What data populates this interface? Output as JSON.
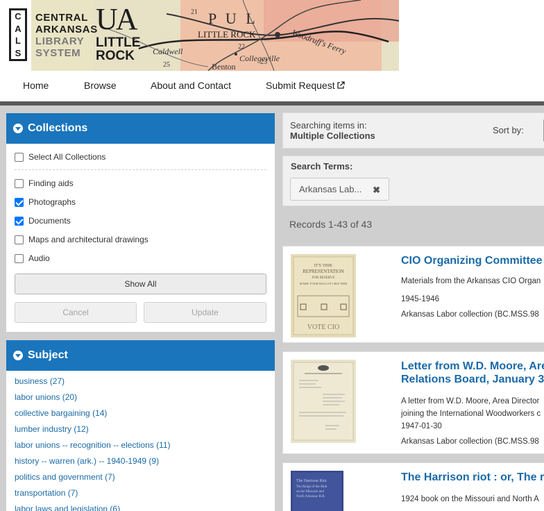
{
  "header": {
    "logo_letters": [
      "C",
      "A",
      "L",
      "S"
    ],
    "logo_lines": [
      "CENTRAL",
      "ARKANSAS",
      "LIBRARY",
      "SYSTEM"
    ],
    "ualr_mark": "UA",
    "ualr_lines": [
      "LITTLE",
      "ROCK"
    ],
    "map_labels": [
      "P  U  L",
      "LITTLE ROCK",
      "Woodruff's Ferry",
      "Caldwell",
      "Collegeville",
      "Benton",
      "22",
      "25",
      "23",
      "21"
    ]
  },
  "nav": {
    "items": [
      {
        "label": "Home"
      },
      {
        "label": "Browse"
      },
      {
        "label": "About and Contact"
      },
      {
        "label": "Submit Request",
        "icon": "external-link-icon"
      }
    ]
  },
  "collections": {
    "title": "Collections",
    "select_all": {
      "label": "Select All Collections",
      "checked": false
    },
    "options": [
      {
        "label": "Finding aids",
        "checked": false
      },
      {
        "label": "Photographs",
        "checked": true
      },
      {
        "label": "Documents",
        "checked": true
      },
      {
        "label": "Maps and architectural drawings",
        "checked": false
      },
      {
        "label": "Audio",
        "checked": false
      }
    ],
    "show_all": "Show All",
    "cancel": "Cancel",
    "update": "Update"
  },
  "subject": {
    "title": "Subject",
    "items": [
      "business (27)",
      "labor unions (20)",
      "collective bargaining (14)",
      "lumber industry (12)",
      "labor unions -- recognition -- elections (11)",
      "history -- warren (ark.) -- 1940-1949 (9)",
      "politics and government (7)",
      "transportation (7)",
      "labor laws and legislation (6)"
    ]
  },
  "search": {
    "searching_in_label": "Searching items in:",
    "searching_in_value": "Multiple Collections",
    "sort_label": "Sort by:",
    "terms_label": "Search Terms:",
    "term_chip": "Arkansas Lab...",
    "term_remove": "✖"
  },
  "records_summary": "Records 1-43 of 43",
  "results": [
    {
      "title_lines": [
        "CIO Organizing Committee"
      ],
      "meta": [
        "Materials from the Arkansas CIO Organ",
        "1945-1946",
        "Arkansas Labor collection (BC.MSS.98"
      ],
      "thumb_text": [
        "IT'S TIME",
        "REPRESENTATION",
        "FOR RESERVE",
        "MARK YOUR BALLOT LIKE THIS",
        "VOTE CIO"
      ]
    },
    {
      "title_lines": [
        "Letter from W.D. Moore, Are",
        "Relations Board, January 3"
      ],
      "meta": [
        "A letter from W.D. Moore, Area Director",
        "joining the International Woodworkers c",
        "1947-01-30",
        "Arkansas Labor collection (BC.MSS.98"
      ]
    },
    {
      "title_lines": [
        "The Harrison riot : or, The r"
      ],
      "meta": [
        "1924 book on the Missouri and North A"
      ],
      "thumb_text": [
        "The Harrison Riot",
        "The Reign of the Mob",
        "on the Missouri and",
        "North Arkansas R.R."
      ]
    }
  ]
}
